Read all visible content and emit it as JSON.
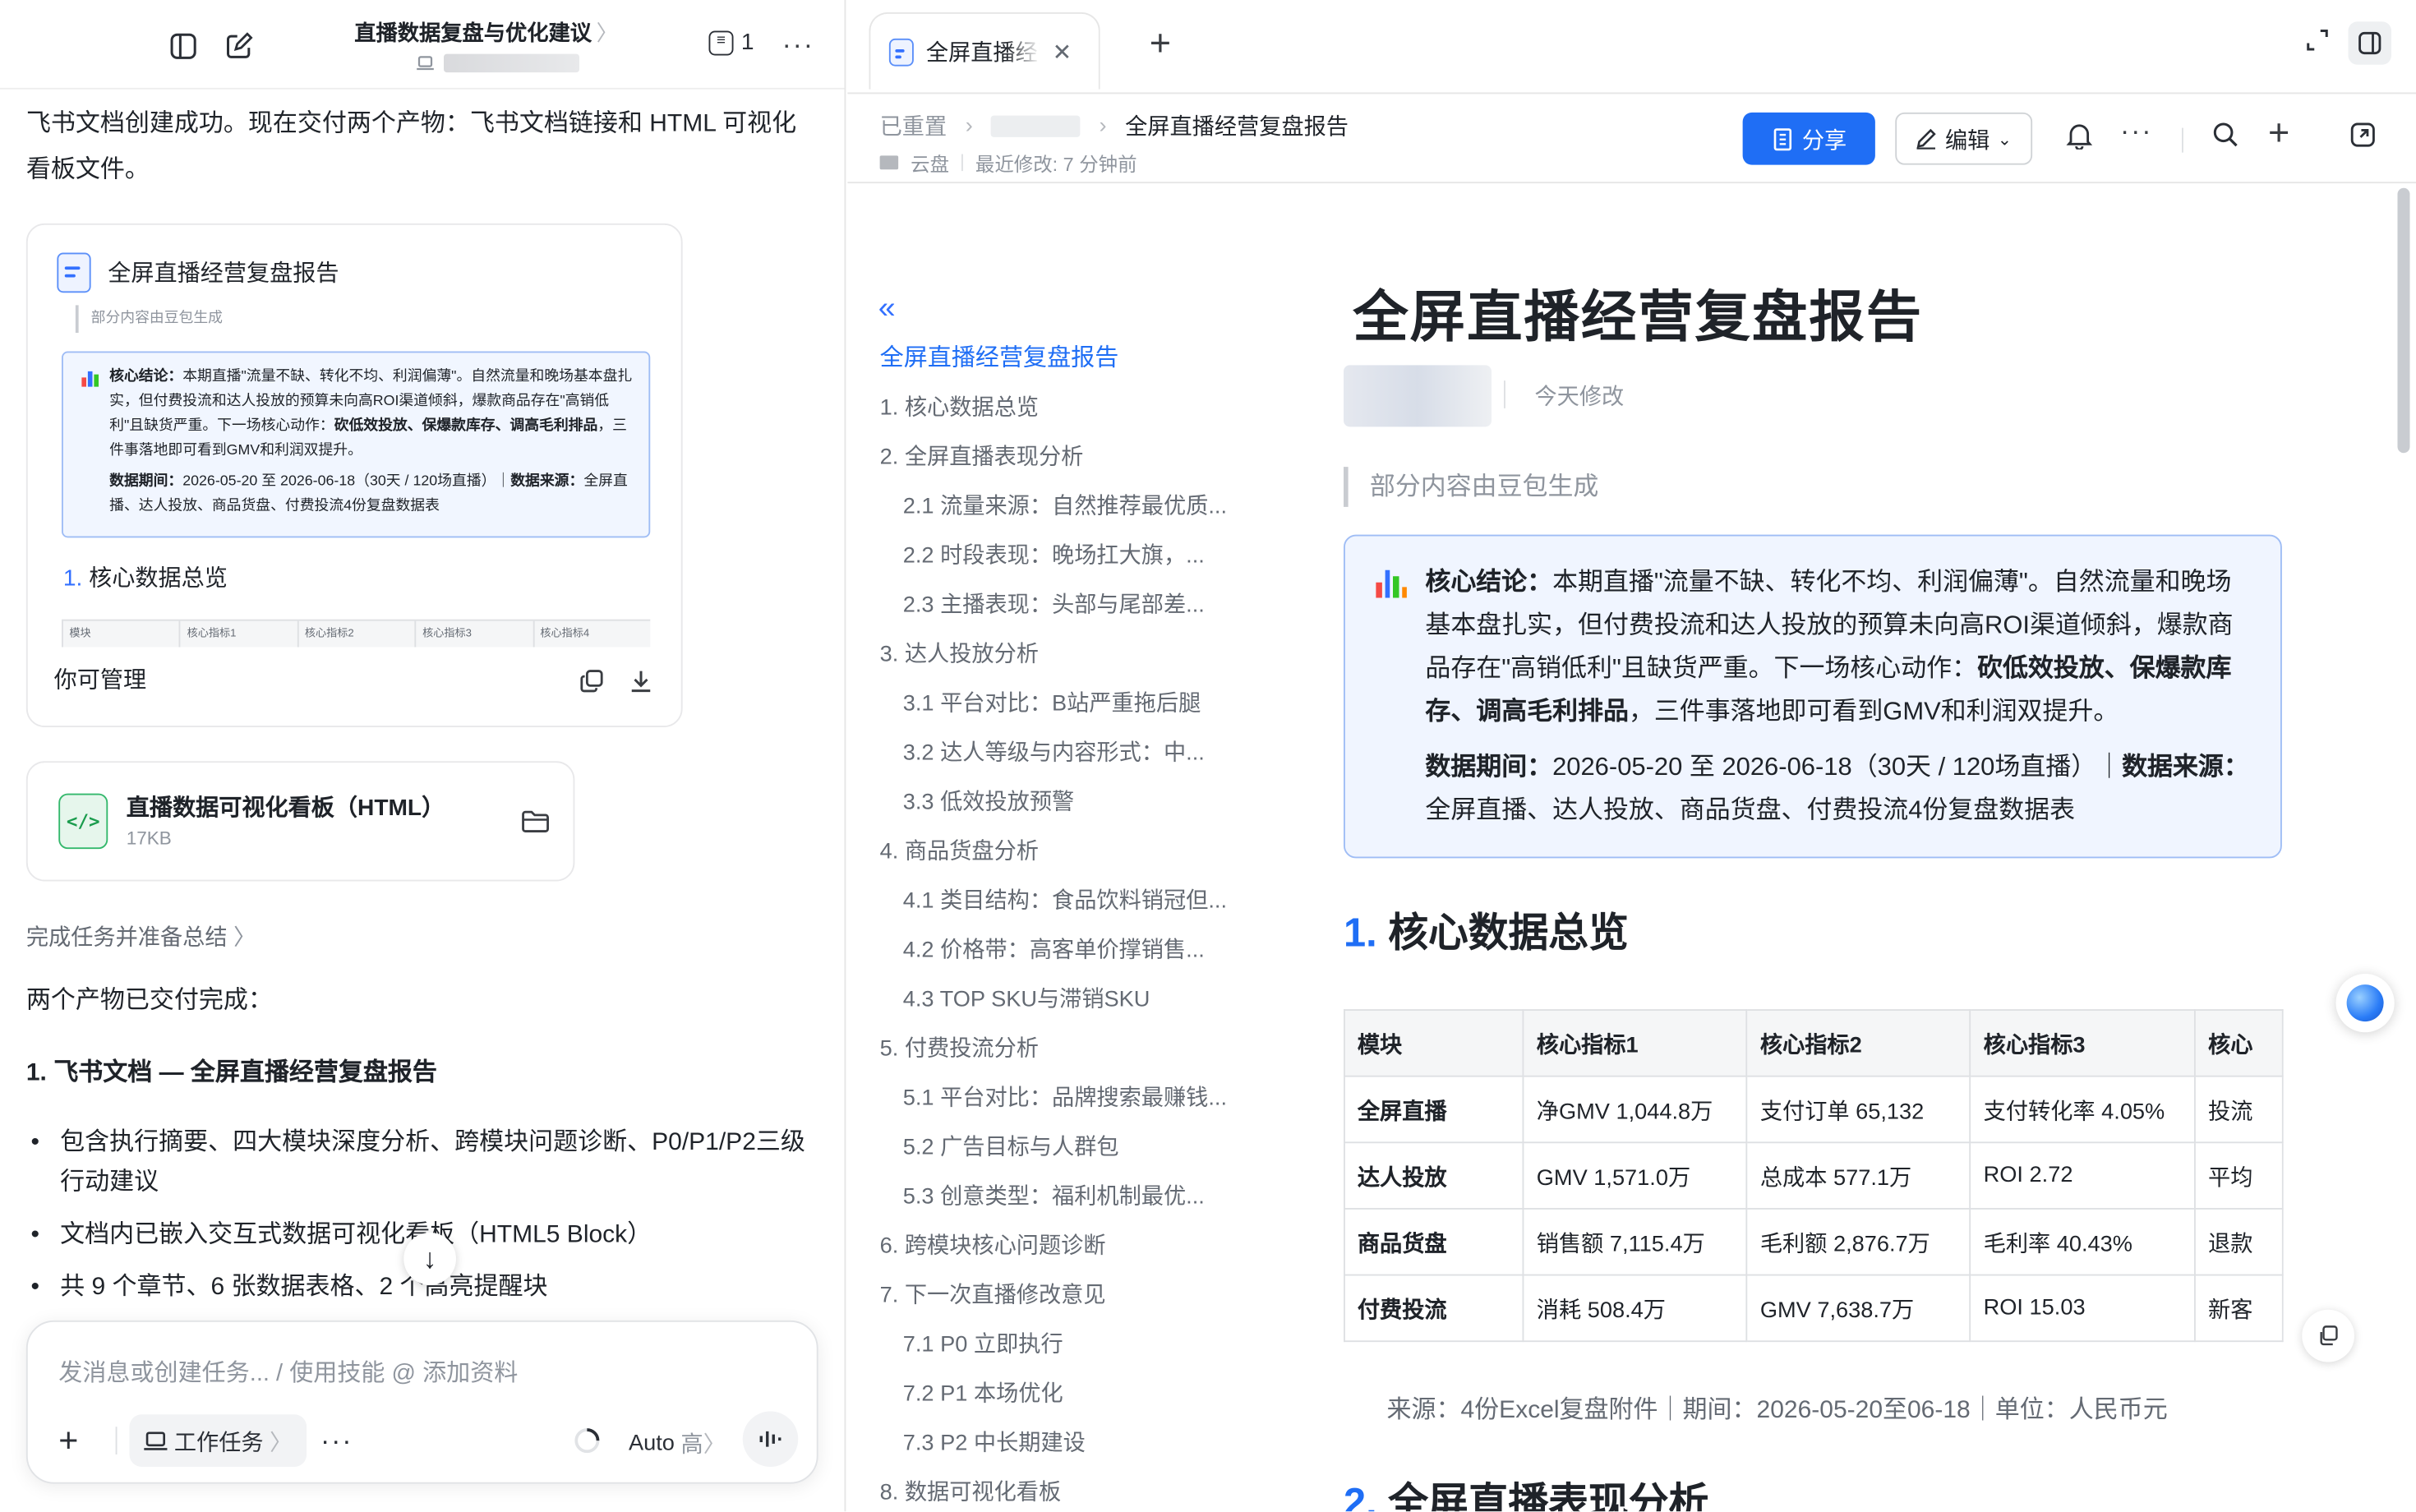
{
  "chat": {
    "title": "直播数据复盘与优化建议",
    "comment_count": "1",
    "intro": "飞书文档创建成功。现在交付两个产物：飞书文档链接和 HTML 可视化看板文件。",
    "doc_card": {
      "title": "全屏直播经营复盘报告",
      "preview_quote": "部分内容由豆包生成",
      "preview_callout_1a": "核心结论：",
      "preview_callout_1b": "本期直播\"流量不缺、转化不均、利润偏薄\"。自然流量和晚场基本盘扎实，但付费投流和达人投放的预算未向高ROI渠道倾斜，爆款商品存在\"高销低利\"且缺货严重。下一场核心动作：",
      "preview_callout_1c": "砍低效投放、保爆款库存、调高毛利排品",
      "preview_callout_1d": "，三件事落地即可看到GMV和利润双提升。",
      "preview_callout_2a": "数据期间：",
      "preview_callout_2b": "2026-05-20 至 2026-06-18（30天 / 120场直播）｜",
      "preview_callout_2c": "数据来源：",
      "preview_callout_2d": "全屏直播、达人投放、商品货盘、付费投流4份复盘数据表",
      "preview_heading_num": "1.",
      "preview_heading": "核心数据总览",
      "preview_table_headers": [
        "模块",
        "核心指标1",
        "核心指标2",
        "核心指标3",
        "核心指标4"
      ],
      "footer": "你可管理"
    },
    "file_card": {
      "title": "直播数据可视化看板（HTML）",
      "size": "17KB"
    },
    "task_link": "完成任务并准备总结",
    "summary": "两个产物已交付完成：",
    "item_heading": "1. 飞书文档 — 全屏直播经营复盘报告",
    "bullets": [
      "包含执行摘要、四大模块深度分析、跨模块问题诊断、P0/P1/P2三级行动建议",
      "文档内已嵌入交互式数据可视化看板（HTML5 Block）",
      "共 9 个章节、6 张数据表格、2 个高亮提醒块"
    ],
    "composer": {
      "placeholder": "发消息或创建任务... / 使用技能 @ 添加资料",
      "work_task_label": "工作任务",
      "mode": "Auto",
      "level": "高"
    }
  },
  "doc_panel": {
    "tab_label": "全屏直播经营复盘报告",
    "breadcrumb_root": "已重置",
    "breadcrumb_current": "全屏直播经营复盘报告",
    "location": "云盘",
    "last_modified": "最近修改: 7 分钟前",
    "share_label": "分享",
    "edit_label": "编辑"
  },
  "outline": {
    "items": [
      {
        "label": "全屏直播经营复盘报告",
        "level": 0,
        "active": true
      },
      {
        "label": "1. 核心数据总览",
        "level": 1
      },
      {
        "label": "2. 全屏直播表现分析",
        "level": 1
      },
      {
        "label": "2.1 流量来源：自然推荐最优质...",
        "level": 2
      },
      {
        "label": "2.2 时段表现：晚场扛大旗，...",
        "level": 2
      },
      {
        "label": "2.3 主播表现：头部与尾部差...",
        "level": 2
      },
      {
        "label": "3. 达人投放分析",
        "level": 1
      },
      {
        "label": "3.1 平台对比：B站严重拖后腿",
        "level": 2
      },
      {
        "label": "3.2 达人等级与内容形式：中...",
        "level": 2
      },
      {
        "label": "3.3 低效投放预警",
        "level": 2
      },
      {
        "label": "4. 商品货盘分析",
        "level": 1
      },
      {
        "label": "4.1 类目结构：食品饮料销冠但...",
        "level": 2
      },
      {
        "label": "4.2 价格带：高客单价撑销售...",
        "level": 2
      },
      {
        "label": "4.3 TOP SKU与滞销SKU",
        "level": 2
      },
      {
        "label": "5. 付费投流分析",
        "level": 1
      },
      {
        "label": "5.1 平台对比：品牌搜索最赚钱...",
        "level": 2
      },
      {
        "label": "5.2 广告目标与人群包",
        "level": 2
      },
      {
        "label": "5.3 创意类型：福利机制最优...",
        "level": 2
      },
      {
        "label": "6. 跨模块核心问题诊断",
        "level": 1
      },
      {
        "label": "7. 下一次直播修改意见",
        "level": 1
      },
      {
        "label": "7.1 P0 立即执行",
        "level": 2
      },
      {
        "label": "7.2 P1 本场优化",
        "level": 2
      },
      {
        "label": "7.3 P2 中长期建设",
        "level": 2
      },
      {
        "label": "8. 数据可视化看板",
        "level": 1
      }
    ]
  },
  "document": {
    "title": "全屏直播经营复盘报告",
    "modified": "今天修改",
    "quote": "部分内容由豆包生成",
    "callout": {
      "p1_label": "核心结论：",
      "p1_text": "本期直播\"流量不缺、转化不均、利润偏薄\"。自然流量和晚场基本盘扎实，但付费投流和达人投放的预算未向高ROI渠道倾斜，爆款商品存在\"高销低利\"且缺货严重。下一场核心动作：",
      "p1_bold": "砍低效投放、保爆款库存、调高毛利排品",
      "p1_tail": "，三件事落地即可看到GMV和利润双提升。",
      "p2_label": "数据期间：",
      "p2_text": "2026-05-20 至 2026-06-18（30天 / 120场直播）｜",
      "p2_label2": "数据来源：",
      "p2_text2": "全屏直播、达人投放、商品货盘、付费投流4份复盘数据表"
    },
    "section1": {
      "num": "1.",
      "title": "核心数据总览"
    },
    "table": {
      "headers": [
        "模块",
        "核心指标1",
        "核心指标2",
        "核心指标3",
        "核心"
      ],
      "rows": [
        [
          "全屏直播",
          "净GMV 1,044.8万",
          "支付订单 65,132",
          "支付转化率 4.05%",
          "投流"
        ],
        [
          "达人投放",
          "GMV 1,571.0万",
          "总成本 577.1万",
          "ROI 2.72",
          "平均"
        ],
        [
          "商品货盘",
          "销售额 7,115.4万",
          "毛利额 2,876.7万",
          "毛利率 40.43%",
          "退款"
        ],
        [
          "付费投流",
          "消耗 508.4万",
          "GMV 7,638.7万",
          "ROI 15.03",
          "新客"
        ]
      ]
    },
    "source_note": "来源：4份Excel复盘附件｜期间：2026-05-20至06-18｜单位：人民币元",
    "section2": {
      "num": "2.",
      "title": "全屏直播表现分析"
    }
  },
  "colors": {
    "accent": "#1f6ef5",
    "callout_bg": "#f0f5ff",
    "callout_border": "#9fbdf5"
  }
}
